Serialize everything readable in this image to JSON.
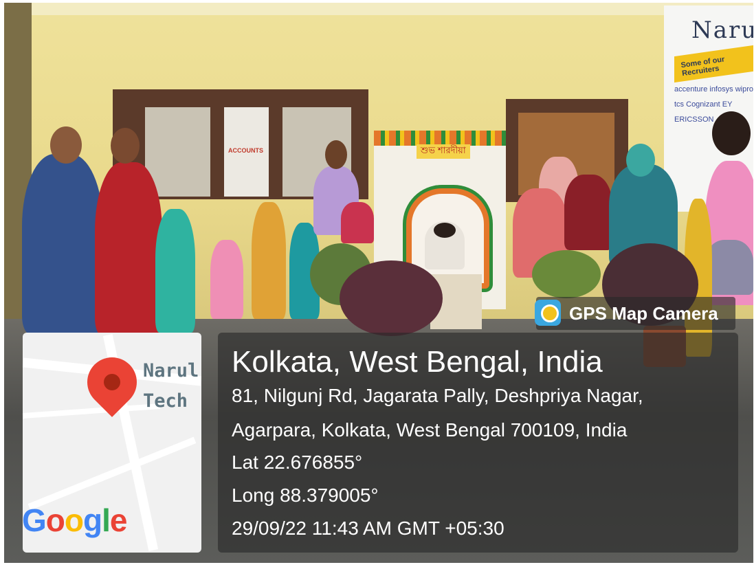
{
  "photo": {
    "description_visible_text": {
      "banner_top": "Narul",
      "banner_sub": "Some of our Recruiters",
      "recruiters": [
        "accenture",
        "infosys",
        "wipro",
        "tcs",
        "Cognizant",
        "EY",
        "ERICSSON"
      ],
      "door_sign": "ACCOUNTS",
      "backdrop_sign": "শুভ শারদীয়া"
    }
  },
  "map": {
    "label_line1": "Narul",
    "label_line2": "Tech",
    "logo": "Google",
    "logo_colors": [
      "#4285f4",
      "#ea4335",
      "#fbbc05",
      "#4285f4",
      "#34a853",
      "#ea4335"
    ],
    "pin_color": "#ea4335"
  },
  "app": {
    "name": "GPS Map Camera",
    "icon": "map-camera-icon"
  },
  "location": {
    "title": "Kolkata, West Bengal, India",
    "address_line1": "81, Nilgunj Rd, Jagarata Pally, Deshpriya Nagar,",
    "address_line2": "Agarpara, Kolkata, West Bengal 700109, India",
    "latitude": "Lat 22.676855°",
    "longitude": "Long 88.379005°",
    "timestamp": "29/09/22 11:43 AM GMT +05:30"
  }
}
